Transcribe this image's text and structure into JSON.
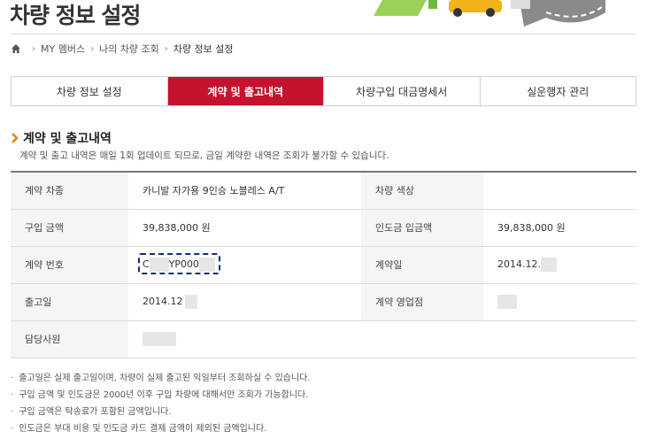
{
  "page": {
    "title": "차량 정보 설정"
  },
  "breadcrumb": {
    "items": [
      "MY 멤버스",
      "나의 차량 조회",
      "차량 정보 설정"
    ]
  },
  "tabs": [
    {
      "label": "차량 정보 설정",
      "active": false
    },
    {
      "label": "계약 및 출고내역",
      "active": true
    },
    {
      "label": "차량구입 대금명세서",
      "active": false
    },
    {
      "label": "실운행자 관리",
      "active": false
    }
  ],
  "section": {
    "title": "계약 및 출고내역",
    "description": "계약 및 출고 내역은 매일 1회 업데이트 되므로, 금일 계약한 내역은 조회가 불가할 수 있습니다."
  },
  "table": {
    "contract_model_label": "계약 차종",
    "contract_model_value": "카니발 자가용 9인승 노블레스 A/T",
    "color_label": "차량 색상",
    "color_value": "",
    "price_label": "구입 금액",
    "price_value": "39,838,000 원",
    "delivery_payment_label": "인도금 입금액",
    "delivery_payment_value": "39,838,000 원",
    "contract_no_label": "계약 번호",
    "contract_no_prefix": "C",
    "contract_no_mid": "YP000",
    "contract_date_label": "계약일",
    "contract_date_value": "2014.12.",
    "release_date_label": "출고일",
    "release_date_value": "2014.12",
    "branch_label": "계약 영업점",
    "staff_label": "담당사원"
  },
  "notes": [
    "출고일은 실제 출고일이며, 차량이 실제 출고된 익일부터 조회하실 수 있습니다.",
    "구입 금액 및 인도금은 2000년 이후 구입 차량에 대해서만 조회가 가능합니다.",
    "구입 금액은 탁송료가 포함된 금액입니다.",
    "인도금은 부대 비용 및 인도금 카드 결제 금액이 제외된 금액입니다."
  ],
  "colors": {
    "accent": "#c4122f",
    "header_rule": "#777777",
    "label_bg": "#f5f5f5",
    "highlight_box": "#1a2a7a"
  },
  "icons": {
    "home": "home-icon",
    "section": "chevron-right-icon"
  }
}
